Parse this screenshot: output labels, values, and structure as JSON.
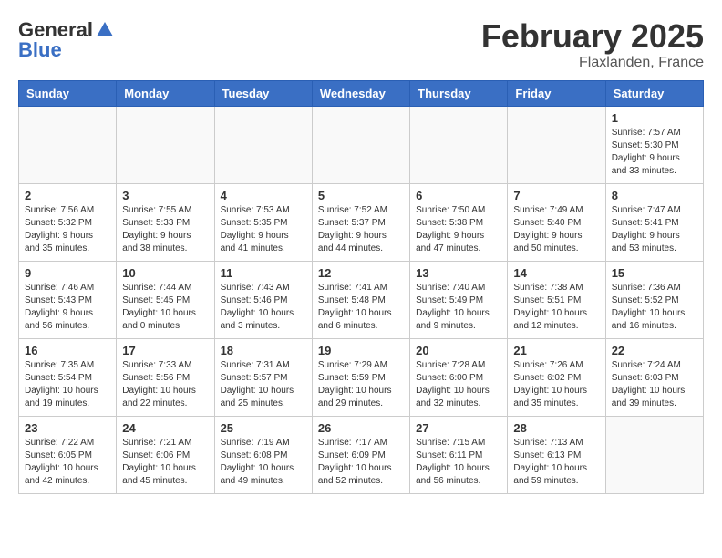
{
  "header": {
    "logo_general": "General",
    "logo_blue": "Blue",
    "month_title": "February 2025",
    "location": "Flaxlanden, France"
  },
  "weekdays": [
    "Sunday",
    "Monday",
    "Tuesday",
    "Wednesday",
    "Thursday",
    "Friday",
    "Saturday"
  ],
  "weeks": [
    [
      {
        "day": "",
        "info": ""
      },
      {
        "day": "",
        "info": ""
      },
      {
        "day": "",
        "info": ""
      },
      {
        "day": "",
        "info": ""
      },
      {
        "day": "",
        "info": ""
      },
      {
        "day": "",
        "info": ""
      },
      {
        "day": "1",
        "info": "Sunrise: 7:57 AM\nSunset: 5:30 PM\nDaylight: 9 hours and 33 minutes."
      }
    ],
    [
      {
        "day": "2",
        "info": "Sunrise: 7:56 AM\nSunset: 5:32 PM\nDaylight: 9 hours and 35 minutes."
      },
      {
        "day": "3",
        "info": "Sunrise: 7:55 AM\nSunset: 5:33 PM\nDaylight: 9 hours and 38 minutes."
      },
      {
        "day": "4",
        "info": "Sunrise: 7:53 AM\nSunset: 5:35 PM\nDaylight: 9 hours and 41 minutes."
      },
      {
        "day": "5",
        "info": "Sunrise: 7:52 AM\nSunset: 5:37 PM\nDaylight: 9 hours and 44 minutes."
      },
      {
        "day": "6",
        "info": "Sunrise: 7:50 AM\nSunset: 5:38 PM\nDaylight: 9 hours and 47 minutes."
      },
      {
        "day": "7",
        "info": "Sunrise: 7:49 AM\nSunset: 5:40 PM\nDaylight: 9 hours and 50 minutes."
      },
      {
        "day": "8",
        "info": "Sunrise: 7:47 AM\nSunset: 5:41 PM\nDaylight: 9 hours and 53 minutes."
      }
    ],
    [
      {
        "day": "9",
        "info": "Sunrise: 7:46 AM\nSunset: 5:43 PM\nDaylight: 9 hours and 56 minutes."
      },
      {
        "day": "10",
        "info": "Sunrise: 7:44 AM\nSunset: 5:45 PM\nDaylight: 10 hours and 0 minutes."
      },
      {
        "day": "11",
        "info": "Sunrise: 7:43 AM\nSunset: 5:46 PM\nDaylight: 10 hours and 3 minutes."
      },
      {
        "day": "12",
        "info": "Sunrise: 7:41 AM\nSunset: 5:48 PM\nDaylight: 10 hours and 6 minutes."
      },
      {
        "day": "13",
        "info": "Sunrise: 7:40 AM\nSunset: 5:49 PM\nDaylight: 10 hours and 9 minutes."
      },
      {
        "day": "14",
        "info": "Sunrise: 7:38 AM\nSunset: 5:51 PM\nDaylight: 10 hours and 12 minutes."
      },
      {
        "day": "15",
        "info": "Sunrise: 7:36 AM\nSunset: 5:52 PM\nDaylight: 10 hours and 16 minutes."
      }
    ],
    [
      {
        "day": "16",
        "info": "Sunrise: 7:35 AM\nSunset: 5:54 PM\nDaylight: 10 hours and 19 minutes."
      },
      {
        "day": "17",
        "info": "Sunrise: 7:33 AM\nSunset: 5:56 PM\nDaylight: 10 hours and 22 minutes."
      },
      {
        "day": "18",
        "info": "Sunrise: 7:31 AM\nSunset: 5:57 PM\nDaylight: 10 hours and 25 minutes."
      },
      {
        "day": "19",
        "info": "Sunrise: 7:29 AM\nSunset: 5:59 PM\nDaylight: 10 hours and 29 minutes."
      },
      {
        "day": "20",
        "info": "Sunrise: 7:28 AM\nSunset: 6:00 PM\nDaylight: 10 hours and 32 minutes."
      },
      {
        "day": "21",
        "info": "Sunrise: 7:26 AM\nSunset: 6:02 PM\nDaylight: 10 hours and 35 minutes."
      },
      {
        "day": "22",
        "info": "Sunrise: 7:24 AM\nSunset: 6:03 PM\nDaylight: 10 hours and 39 minutes."
      }
    ],
    [
      {
        "day": "23",
        "info": "Sunrise: 7:22 AM\nSunset: 6:05 PM\nDaylight: 10 hours and 42 minutes."
      },
      {
        "day": "24",
        "info": "Sunrise: 7:21 AM\nSunset: 6:06 PM\nDaylight: 10 hours and 45 minutes."
      },
      {
        "day": "25",
        "info": "Sunrise: 7:19 AM\nSunset: 6:08 PM\nDaylight: 10 hours and 49 minutes."
      },
      {
        "day": "26",
        "info": "Sunrise: 7:17 AM\nSunset: 6:09 PM\nDaylight: 10 hours and 52 minutes."
      },
      {
        "day": "27",
        "info": "Sunrise: 7:15 AM\nSunset: 6:11 PM\nDaylight: 10 hours and 56 minutes."
      },
      {
        "day": "28",
        "info": "Sunrise: 7:13 AM\nSunset: 6:13 PM\nDaylight: 10 hours and 59 minutes."
      },
      {
        "day": "",
        "info": ""
      }
    ]
  ]
}
